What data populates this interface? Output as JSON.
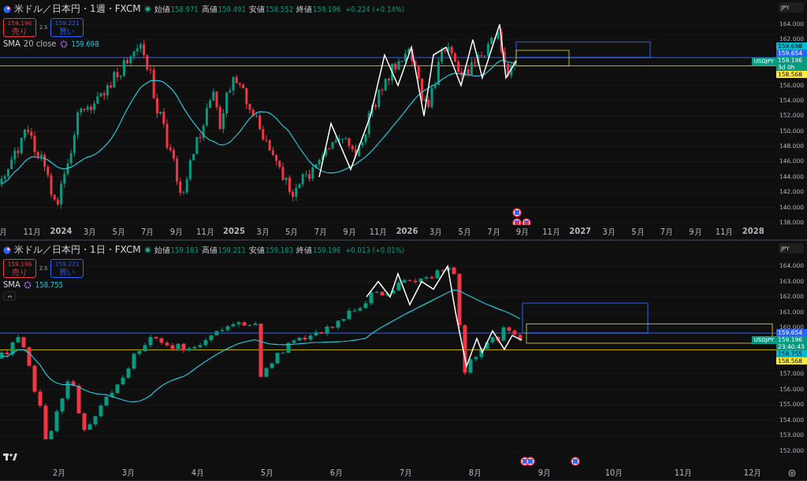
{
  "panels": [
    {
      "title": "米ドル／日本円・1週・FXCM",
      "ohlc": [
        {
          "label": "始値",
          "value": "158.971"
        },
        {
          "label": "高値",
          "value": "159.491"
        },
        {
          "label": "安値",
          "value": "158.552"
        },
        {
          "label": "終値",
          "value": "159.196"
        }
      ],
      "change": "+0.224 (+0.14%)",
      "sell": {
        "price": "159.196",
        "label": "売り"
      },
      "spread": "2.5",
      "buy": {
        "price": "159.221",
        "label": "買い"
      },
      "indicator": {
        "name": "SMA",
        "params": "20 close",
        "value": "159.698"
      },
      "currency": "JPY",
      "price_axis": [
        "164.000",
        "162.000",
        "156.000",
        "154.000",
        "152.000",
        "150.000",
        "148.000",
        "146.000",
        "144.000",
        "142.000",
        "140.000",
        "138.000"
      ],
      "symbol_tag": "USDJPY",
      "price_tags": [
        {
          "value": "159.698",
          "color": "#00bcd4"
        },
        {
          "value": "159.654",
          "color": "#2962ff"
        },
        {
          "value": "159.196",
          "sub": "3d 0h",
          "color": "#089981"
        },
        {
          "value": "158.568",
          "color": "#ffeb3b"
        }
      ],
      "time_axis": [
        "月",
        "11月",
        "2024",
        "3月",
        "5月",
        "7月",
        "9月",
        "11月",
        "2025",
        "3月",
        "5月",
        "7月",
        "9月",
        "11月",
        "2026",
        "3月",
        "5月",
        "7月",
        "9月",
        "11月",
        "2027",
        "3月",
        "5月",
        "7月",
        "9月",
        "11月",
        "2028"
      ]
    },
    {
      "title": "米ドル／日本円・1日・FXCM",
      "ohlc": [
        {
          "label": "始値",
          "value": "159.183"
        },
        {
          "label": "高値",
          "value": "159.211"
        },
        {
          "label": "安値",
          "value": "159.183"
        },
        {
          "label": "終値",
          "value": "159.196"
        }
      ],
      "change": "+0.013 (+0.01%)",
      "sell": {
        "price": "159.196",
        "label": "売り"
      },
      "spread": "2.5",
      "buy": {
        "price": "159.221",
        "label": "買い"
      },
      "indicator": {
        "name": "SMA",
        "value": "158.755"
      },
      "currency": "JPY",
      "price_axis": [
        "164.000",
        "163.000",
        "162.000",
        "161.000",
        "160.000",
        "157.000",
        "156.000",
        "155.000",
        "154.000",
        "153.000",
        "152.000"
      ],
      "symbol_tag": "USDJPY",
      "price_tags": [
        {
          "value": "159.654",
          "color": "#2962ff"
        },
        {
          "value": "159.196",
          "sub": "23:40:43",
          "color": "#089981"
        },
        {
          "value": "158.755",
          "color": "#00bcd4"
        },
        {
          "value": "158.568",
          "color": "#ffeb3b"
        }
      ],
      "time_axis": [
        "2月",
        "3月",
        "4月",
        "5月",
        "6月",
        "7月",
        "8月",
        "9月",
        "10月",
        "11月",
        "12月"
      ]
    }
  ]
}
